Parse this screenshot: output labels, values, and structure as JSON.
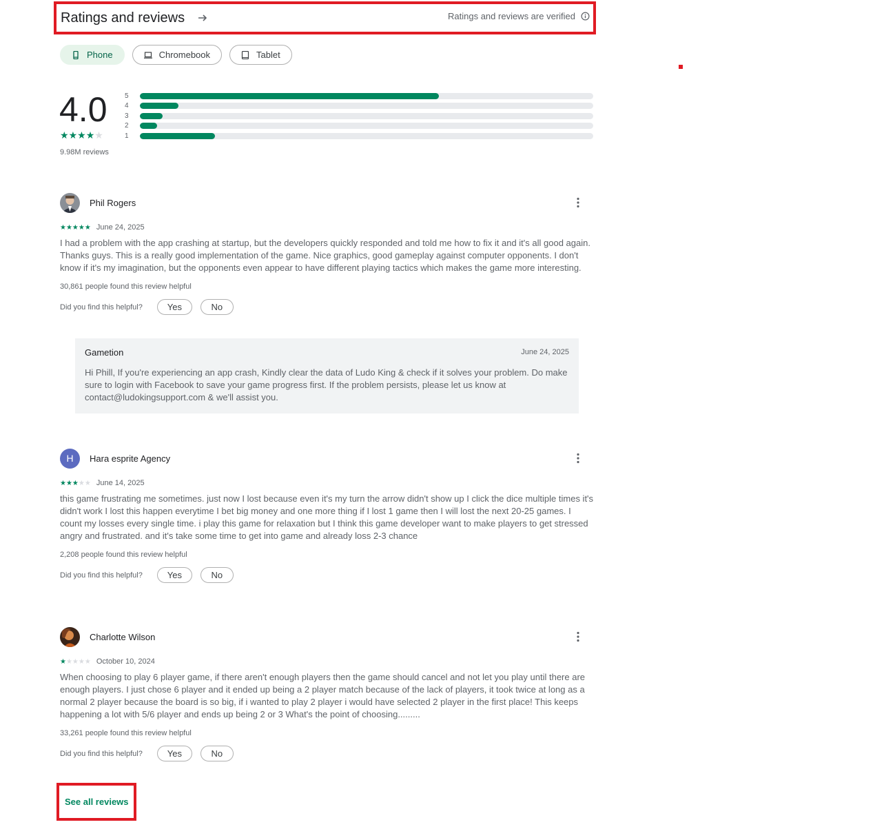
{
  "header": {
    "title": "Ratings and reviews",
    "verified_text": "Ratings and reviews are verified"
  },
  "device_chips": [
    {
      "label": "Phone",
      "icon": "phone-icon",
      "active": true
    },
    {
      "label": "Chromebook",
      "icon": "laptop-icon",
      "active": false
    },
    {
      "label": "Tablet",
      "icon": "tablet-icon",
      "active": false
    }
  ],
  "summary": {
    "score": "4.0",
    "stars": 4,
    "total_reviews": "9.98M reviews",
    "distribution": [
      {
        "label": "5",
        "fraction": 0.66
      },
      {
        "label": "4",
        "fraction": 0.085
      },
      {
        "label": "3",
        "fraction": 0.05
      },
      {
        "label": "2",
        "fraction": 0.038
      },
      {
        "label": "1",
        "fraction": 0.165
      }
    ]
  },
  "reviews": [
    {
      "name": "Phil Rogers",
      "stars": 5,
      "date": "June 24, 2025",
      "text": "I had a problem with the app crashing at startup, but the developers quickly responded and told me how to fix it and it's all good again. Thanks guys. This is a really good implementation of the game. Nice graphics, good gameplay against computer opponents. I don't know if it's my imagination, but the opponents even appear to have different playing tactics which makes the game more interesting.",
      "helpful_count": "30,861 people found this review helpful"
    },
    {
      "name": "Hara esprite Agency",
      "avatar_letter": "H",
      "stars": 3,
      "date": "June 14, 2025",
      "text": "this game frustrating me sometimes. just now I lost because even it's my turn the arrow didn't show up I click the dice multiple times it's didn't work I lost this happen everytime I bet big money and one more thing if I lost 1 game then I will lost the next 20-25 games. I count my losses every single time. i play this game for relaxation but I think this game developer want to make players to get stressed angry and frustrated. and it's take some time to get into game and already loss 2-3 chance",
      "helpful_count": "2,208 people found this review helpful"
    },
    {
      "name": "Charlotte Wilson",
      "stars": 1,
      "date": "October 10, 2024",
      "text": "When choosing to play 6 player game, if there aren't enough players then the game should cancel and not let you play until there are enough players. I just chose 6 player and it ended up being a 2 player match because of the lack of players, it took twice at long as a normal 2 player because the board is so big, if i wanted to play 2 player i would have selected 2 player in the first place! This keeps happening a lot with 5/6 player and ends up being 2 or 3 What's the point of choosing.........",
      "helpful_count": "33,261 people found this review helpful"
    }
  ],
  "helpful_prompt": "Did you find this helpful?",
  "yes_label": "Yes",
  "no_label": "No",
  "developer_reply": {
    "name": "Gametion",
    "date": "June 24, 2025",
    "text": "Hi Phill, If you're experiencing an app crash, Kindly clear the data of Ludo King & check if it solves your problem. Do make sure to login with Facebook to save your game progress first. If the problem persists, please let us know at contact@ludokingsupport.com & we'll assist you."
  },
  "see_all_label": "See all reviews",
  "colors": {
    "accent": "#01875f",
    "highlight": "#e01b24",
    "avatar_h": "#5c6bc0"
  }
}
